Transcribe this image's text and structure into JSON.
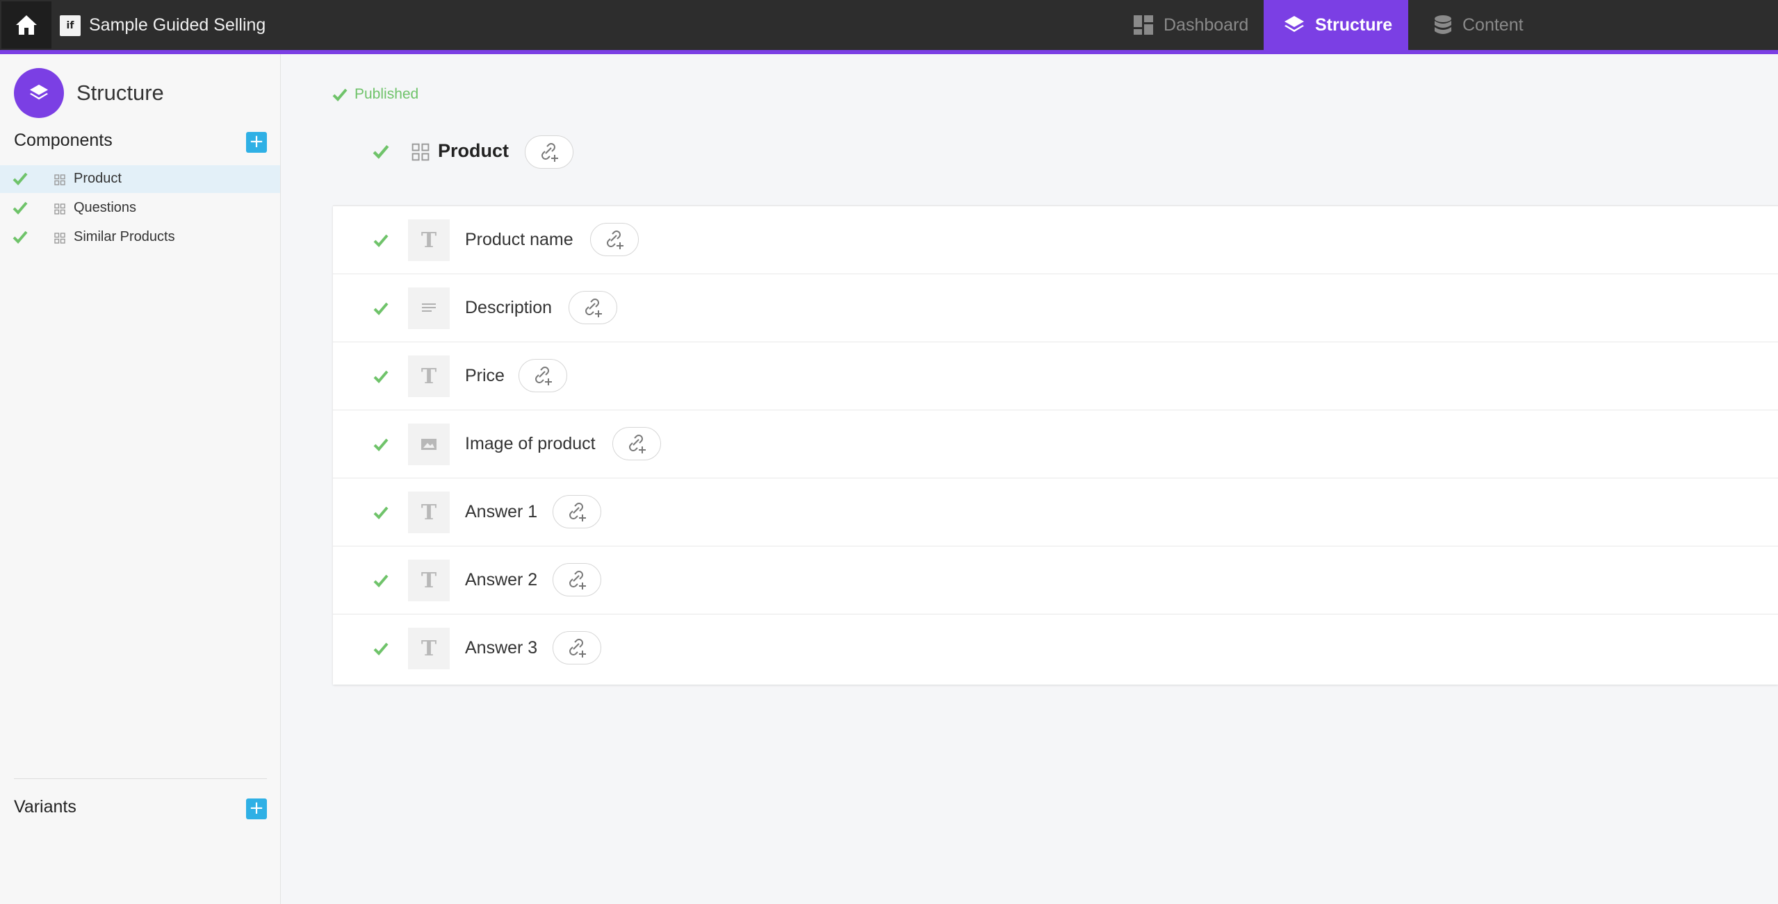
{
  "topbar": {
    "app_title": "Sample Guided Selling",
    "app_logo_text": "if",
    "tabs": [
      {
        "label": "Dashboard",
        "icon": "dashboard-icon",
        "active": false
      },
      {
        "label": "Structure",
        "icon": "layers-icon",
        "active": true
      },
      {
        "label": "Content",
        "icon": "database-icon",
        "active": false
      }
    ],
    "accent_color": "#7b3fe4"
  },
  "sidebar": {
    "title": "Structure",
    "components_heading": "Components",
    "components_add": "+",
    "components": [
      {
        "label": "Product",
        "selected": true
      },
      {
        "label": "Questions",
        "selected": false
      },
      {
        "label": "Similar Products",
        "selected": false
      }
    ],
    "variants_heading": "Variants",
    "variants_add": "+"
  },
  "main": {
    "status": "Published",
    "component_title": "Product",
    "fields": [
      {
        "label": "Product name",
        "type": "text-icon"
      },
      {
        "label": "Description",
        "type": "paragraph-icon"
      },
      {
        "label": "Price",
        "type": "text-icon"
      },
      {
        "label": "Image of product",
        "type": "image-icon"
      },
      {
        "label": "Answer 1",
        "type": "text-icon"
      },
      {
        "label": "Answer 2",
        "type": "text-icon"
      },
      {
        "label": "Answer 3",
        "type": "text-icon"
      }
    ]
  },
  "colors": {
    "check_green": "#6fc36a",
    "add_blue": "#2fb0e5"
  }
}
